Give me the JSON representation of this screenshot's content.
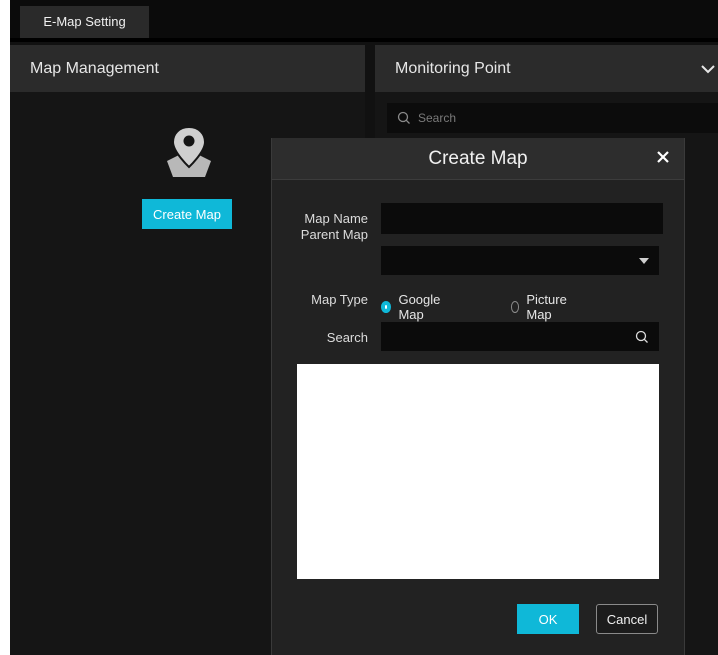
{
  "tabs": [
    {
      "label": "E-Map Setting"
    }
  ],
  "left_panel": {
    "title": "Map Management",
    "create_button": "Create Map",
    "icon": "map-pin-icon"
  },
  "right_panel": {
    "title": "Monitoring Point",
    "search_placeholder": "Search"
  },
  "dialog": {
    "title": "Create Map",
    "fields": {
      "map_name_label": "Map Name",
      "map_name_value": "",
      "parent_map_label": "Parent Map",
      "parent_map_value": "",
      "map_type_label": "Map Type",
      "map_type_options": [
        {
          "label": "Google Map",
          "selected": true
        },
        {
          "label": "Picture Map",
          "selected": false
        }
      ],
      "search_label": "Search",
      "search_value": ""
    },
    "ok_label": "OK",
    "cancel_label": "Cancel"
  },
  "colors": {
    "accent": "#0fb8d8",
    "background": "#151515",
    "header": "#2b2b2b",
    "dialog": "#222222"
  }
}
